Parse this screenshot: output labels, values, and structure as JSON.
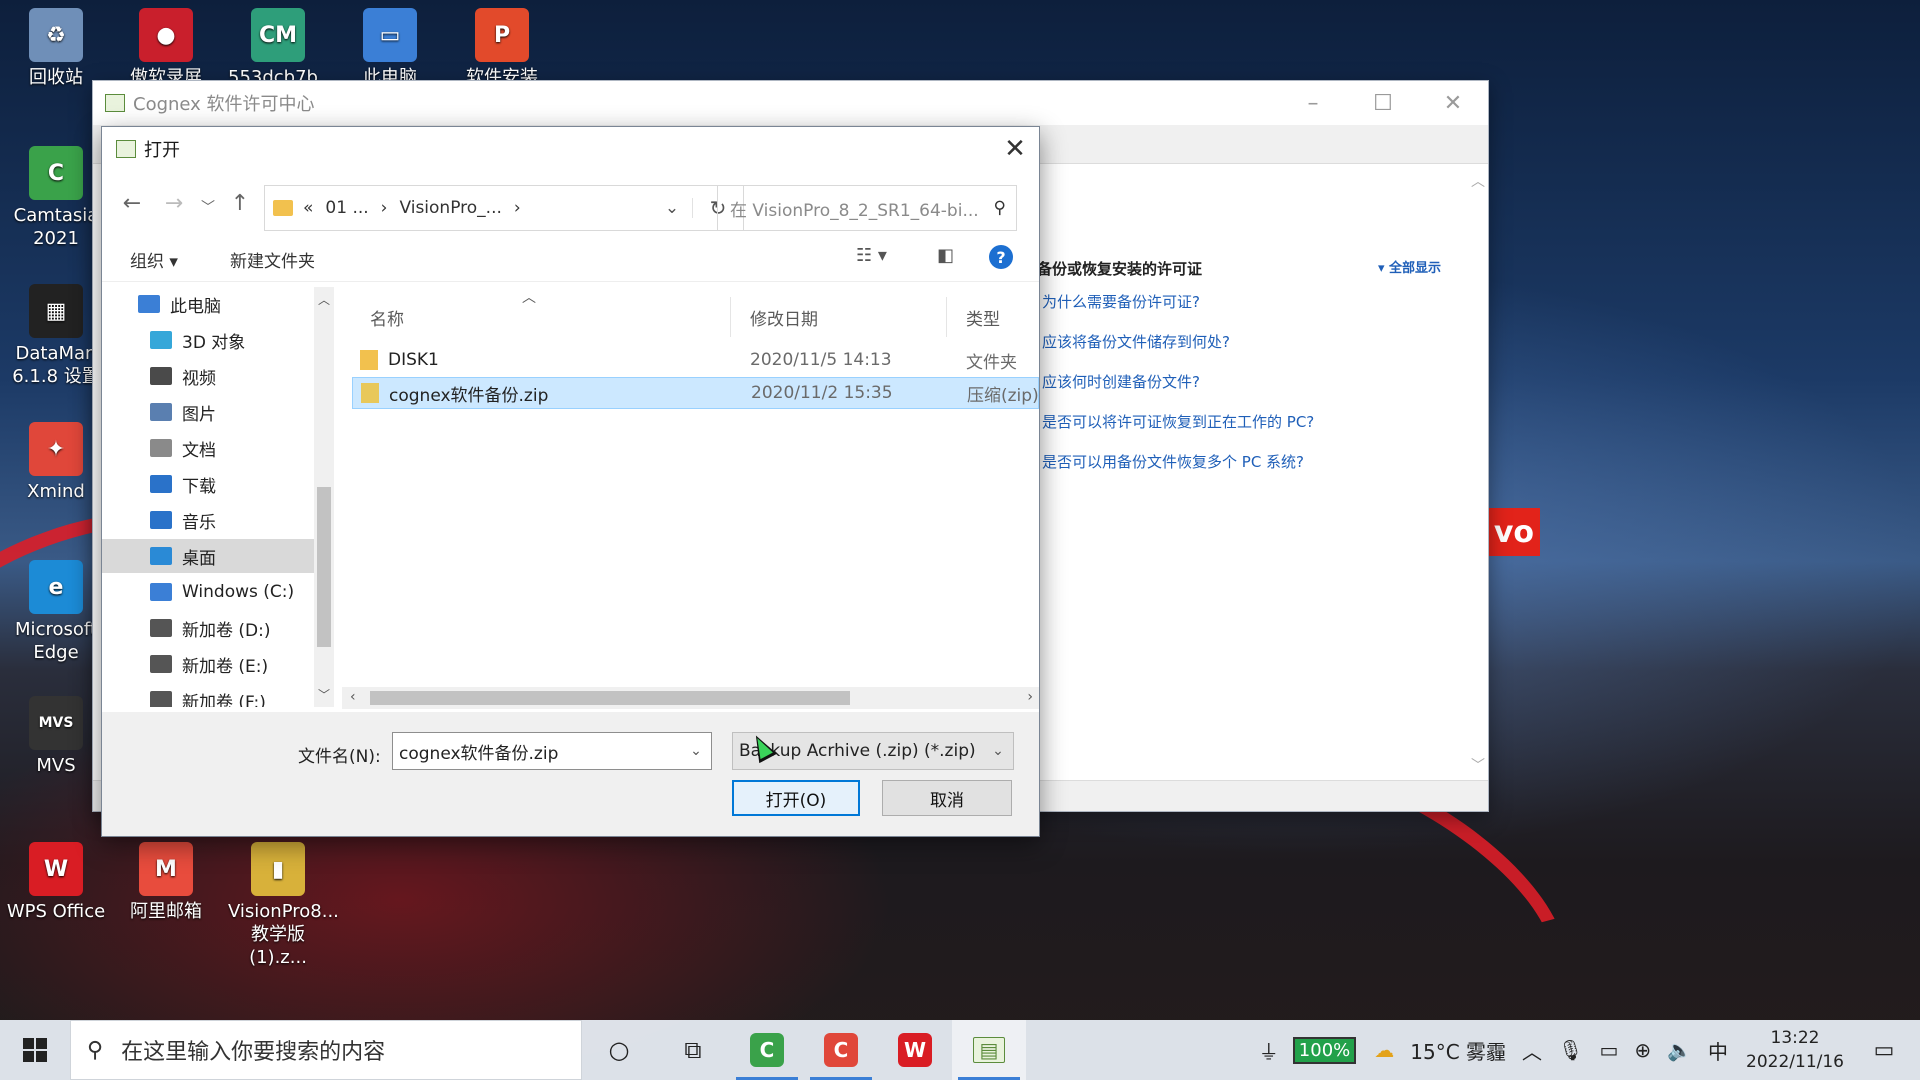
{
  "desktop": {
    "icons": [
      {
        "label": "回收站",
        "color": "#6f8fb8",
        "glyph": "♻"
      },
      {
        "label": "傲软录屏",
        "color": "#c91f2c",
        "glyph": "●"
      },
      {
        "label": "553dcb7b...",
        "color": "#2e9e7a",
        "glyph": "CM"
      },
      {
        "label": "此电脑",
        "color": "#3b7fd6",
        "glyph": "▭"
      },
      {
        "label": "软件安装",
        "color": "#e24a2b",
        "glyph": "P"
      },
      {
        "label": "Camtasia 2021",
        "color": "#3aa24a",
        "glyph": "C"
      },
      {
        "label": "DataMan 6.1.8 设置",
        "color": "#222222",
        "glyph": "▦"
      },
      {
        "label": "Xmind",
        "color": "#e0473a",
        "glyph": "✦"
      },
      {
        "label": "Microsoft Edge",
        "color": "#1c8bd6",
        "glyph": "e"
      },
      {
        "label": "MVS",
        "color": "#333333",
        "glyph": "MVS"
      },
      {
        "label": "WPS Office",
        "color": "#d91d24",
        "glyph": "W"
      },
      {
        "label": "阿里邮箱",
        "color": "#e84c3d",
        "glyph": "M"
      },
      {
        "label": "VisionPro8... 教学版 (1).z...",
        "color": "#d8b13a",
        "glyph": "▮"
      }
    ],
    "brand_fragment": "vo"
  },
  "bg_window": {
    "title": "Cognex 软件许可中心",
    "section_header": "备份或恢复安装的许可证",
    "show_all": "▾ 全部显示",
    "links": [
      "为什么需要备份许可证?",
      "应该将备份文件储存到何处?",
      "应该何时创建备份文件?",
      "是否可以将许可证恢复到正在工作的 PC?",
      "是否可以用备份文件恢复多个 PC 系统?"
    ]
  },
  "dialog": {
    "title": "打开",
    "address": {
      "prefix": "«",
      "segments": [
        "01 ...",
        "VisionPro_..."
      ]
    },
    "search_placeholder": "在 VisionPro_8_2_SR1_64-bi...",
    "toolbar": {
      "organize": "组织 ▾",
      "new_folder": "新建文件夹",
      "help": "?"
    },
    "tree": [
      {
        "label": "此电脑",
        "icon": "computer-icon",
        "color": "#3b7fd6"
      },
      {
        "label": "3D 对象",
        "icon": "cube-icon",
        "color": "#35a7d9"
      },
      {
        "label": "视频",
        "icon": "video-icon",
        "color": "#4a4a4a"
      },
      {
        "label": "图片",
        "icon": "picture-icon",
        "color": "#5a7fb0"
      },
      {
        "label": "文档",
        "icon": "document-icon",
        "color": "#8a8a8a"
      },
      {
        "label": "下载",
        "icon": "download-icon",
        "color": "#2a72c9"
      },
      {
        "label": "音乐",
        "icon": "music-icon",
        "color": "#2a72c9"
      },
      {
        "label": "桌面",
        "icon": "desktop-icon",
        "color": "#2a8ad6"
      },
      {
        "label": "Windows (C:)",
        "icon": "drive-icon",
        "color": "#3b7fd6"
      },
      {
        "label": "新加卷 (D:)",
        "icon": "drive-icon",
        "color": "#555555"
      },
      {
        "label": "新加卷 (E:)",
        "icon": "drive-icon",
        "color": "#555555"
      },
      {
        "label": "新加卷 (F:)",
        "icon": "drive-icon",
        "color": "#555555"
      }
    ],
    "columns": {
      "name": "名称",
      "date": "修改日期",
      "type": "类型"
    },
    "files": [
      {
        "name": "DISK1",
        "date": "2020/11/5 14:13",
        "type": "文件夹",
        "icon": "folder-icon"
      },
      {
        "name": "cognex软件备份.zip",
        "date": "2020/11/2 15:35",
        "type": "压缩(zip)",
        "icon": "zip-icon"
      }
    ],
    "filename_label": "文件名(N):",
    "filename_value": "cognex软件备份.zip",
    "filetype_value": "Backup Acrhive (.zip) (*.zip)",
    "open_button": "打开(O)",
    "cancel_button": "取消"
  },
  "taskbar": {
    "search_placeholder": "在这里输入你要搜索的内容",
    "battery": "100%",
    "weather": "15°C 雾霾",
    "ime": "中",
    "time": "13:22",
    "date": "2022/11/16"
  }
}
